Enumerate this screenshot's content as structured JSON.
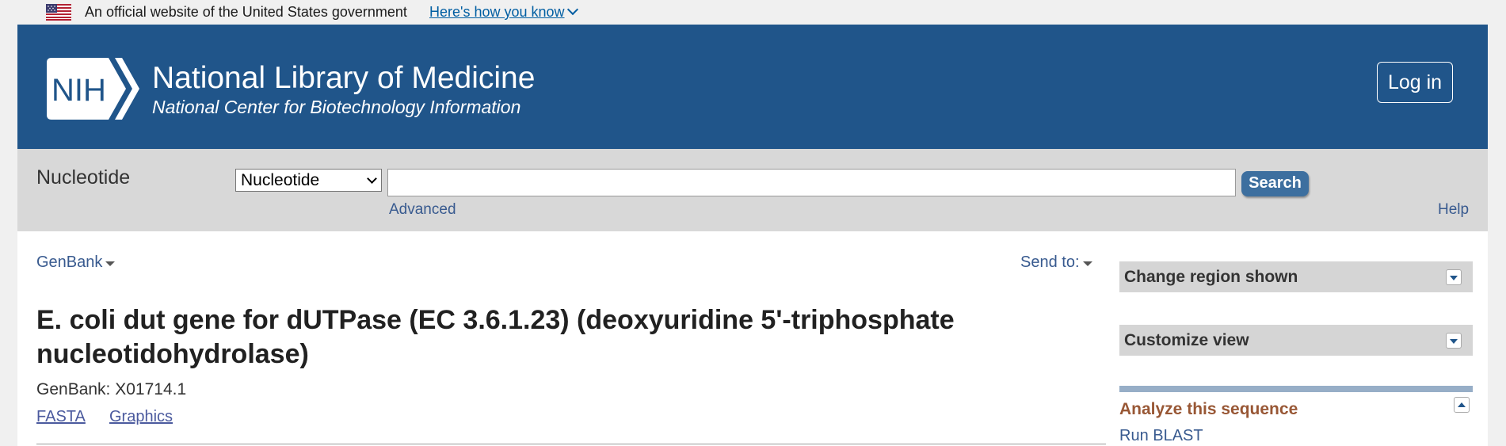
{
  "gov_banner": {
    "text": "An official website of the United States government",
    "link": "Here's how you know",
    "flag_icon": "us-flag-icon"
  },
  "header": {
    "logo_text": "NIH",
    "title": "National Library of Medicine",
    "subtitle": "National Center for Biotechnology Information",
    "login_label": "Log in",
    "background_color": "#20558a"
  },
  "search": {
    "database_title": "Nucleotide",
    "database_selected": "Nucleotide",
    "query_value": "",
    "button_label": "Search",
    "advanced_label": "Advanced",
    "help_label": "Help"
  },
  "record": {
    "format_menu": "GenBank",
    "send_to": "Send to:",
    "title": "E. coli dut gene for dUTPase (EC 3.6.1.23) (deoxyuridine 5'-triphosphate nucleotidohydrolase)",
    "accession_line": "GenBank: X01714.1",
    "links": [
      "FASTA",
      "Graphics"
    ]
  },
  "sidebar": {
    "change_region": "Change region shown",
    "customize_view": "Customize view",
    "analyze_title": "Analyze this sequence",
    "run_blast": "Run BLAST",
    "analyze_color": "#985735"
  }
}
